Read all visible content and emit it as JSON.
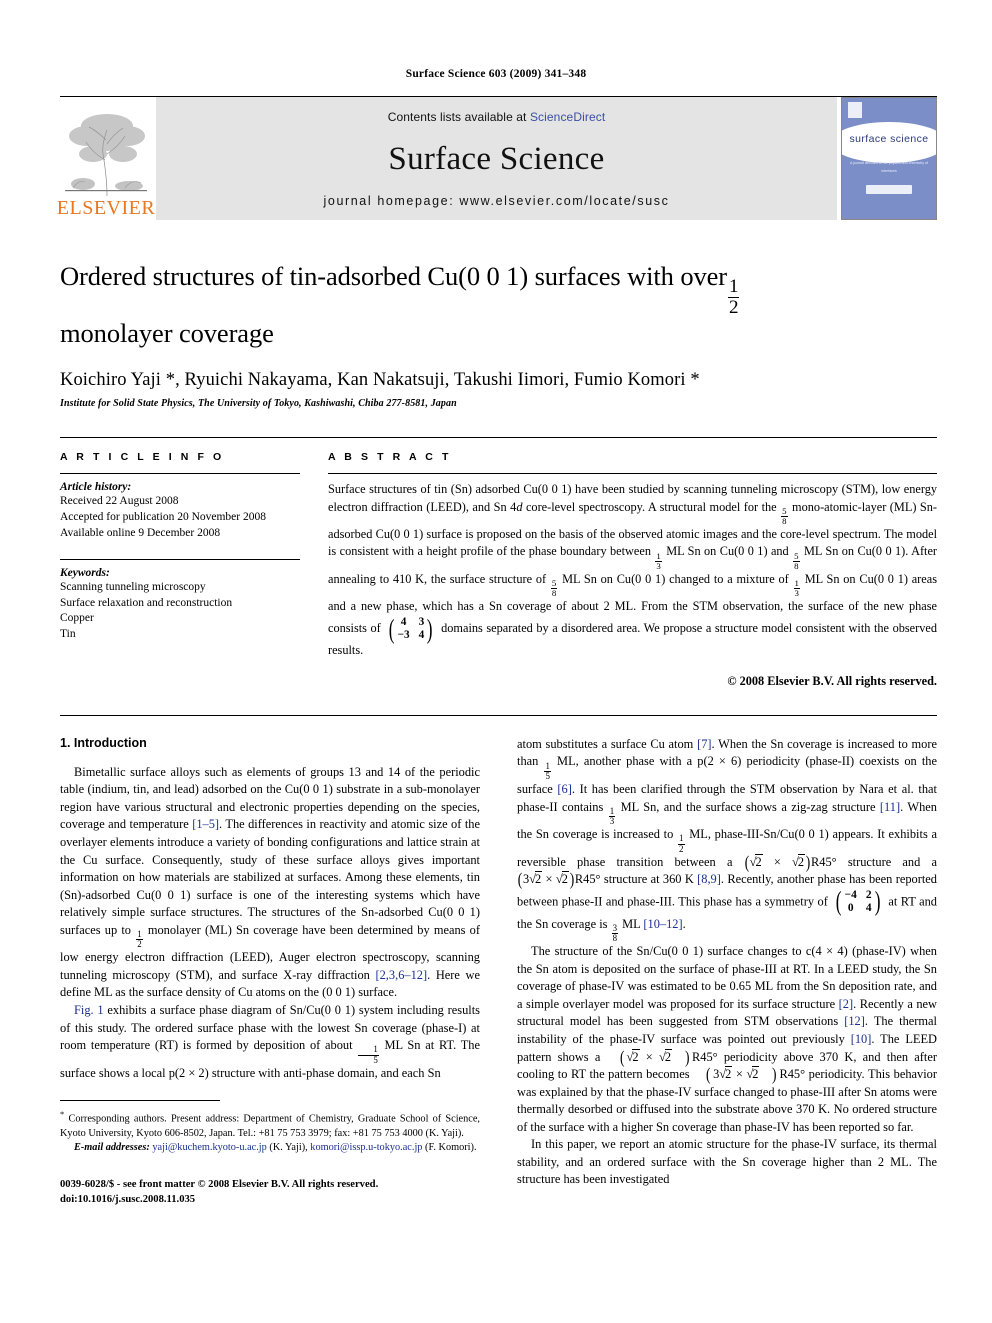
{
  "running_head": "Surface Science 603 (2009) 341–348",
  "masthead": {
    "contents_prefix": "Contents lists available at",
    "sciencedirect": "ScienceDirect",
    "journal_name": "Surface Science",
    "homepage": "journal homepage: www.elsevier.com/locate/susc",
    "elsevier_wordmark": "ELSEVIER",
    "cover_title": "surface science",
    "cover_tagline": "A journal devoted to the physics and chemistry of interfaces",
    "accent_link_color": "#3a4ea8",
    "elsevier_orange": "#E87722",
    "cover_blue": "#7b8ec8"
  },
  "article": {
    "title_line1": "Ordered structures of tin-adsorbed Cu(0 0 1) surfaces with over",
    "title_fraction": "1/2",
    "title_line2": "monolayer coverage",
    "authors": "Koichiro Yaji *, Ryuichi Nakayama, Kan Nakatsuji, Takushi Iimori, Fumio Komori *",
    "affiliation": "Institute for Solid State Physics, The University of Tokyo, Kashiwashi, Chiba 277-8581, Japan"
  },
  "article_info": {
    "heading": "A R T I C L E   I N F O",
    "history_label": "Article history:",
    "history": [
      "Received 22 August 2008",
      "Accepted for publication 20 November 2008",
      "Available online 9 December 2008"
    ],
    "keywords_label": "Keywords:",
    "keywords": [
      "Scanning tunneling microscopy",
      "Surface relaxation and reconstruction",
      "Copper",
      "Tin"
    ]
  },
  "abstract": {
    "heading": "A B S T R A C T",
    "p1_a": "Surface structures of tin (Sn) adsorbed Cu(0 0 1) have been studied by scanning tunneling microscopy (STM), low energy electron diffraction (LEED), and Sn 4",
    "p1_d": "d",
    "p1_b": " core-level spectroscopy. A structural model for the ",
    "frac_5_8": "5/8",
    "p1_c": " mono-atomic-layer (ML) Sn-adsorbed Cu(0 0 1) surface is proposed on the basis of the observed atomic images and the core-level spectrum. The model is consistent with a height profile of the phase boundary between ",
    "frac_1_3": "1/3",
    "p1_e": " ML Sn on Cu(0 0 1) and ",
    "p1_f": " ML Sn on Cu(0 0 1). After annealing to 410 K, the surface structure of ",
    "p1_g": " ML Sn on Cu(0 0 1) changed to a mixture of ",
    "p1_h": " ML Sn on Cu(0 0 1) areas and a new phase, which has a Sn coverage of about 2 ML. From the STM observation, the surface of the new phase consists of ",
    "matrix": [
      [
        "4",
        "3"
      ],
      [
        "−3",
        "4"
      ]
    ],
    "p1_i": " domains separated by a disordered area. We propose a structure model consistent with the observed results.",
    "copyright": "© 2008 Elsevier B.V. All rights reserved."
  },
  "introduction": {
    "heading": "1. Introduction",
    "left": {
      "p1_a": "Bimetallic surface alloys such as elements of groups 13 and 14 of the periodic table (indium, tin, and lead) adsorbed on the Cu(0 0 1) substrate in a sub-monolayer region have various structural and electronic properties depending on the species, coverage and temperature ",
      "ref_1_5": "[1–5]",
      "p1_b": ". The differences in reactivity and atomic size of the overlayer elements introduce a variety of bonding configurations and lattice strain at the Cu surface. Consequently, study of these surface alloys gives important information on how materials are stabilized at surfaces. Among these elements, tin (Sn)-adsorbed Cu(0 0 1) surface is one of the interesting systems which have relatively simple surface structures. The structures of the Sn-adsorbed Cu(0 0 1) surfaces up to ",
      "frac_1_2": "1/2",
      "p1_c": " monolayer (ML) Sn coverage have been determined by means of low energy electron diffraction (LEED), Auger electron spectroscopy, scanning tunneling microscopy (STM), and surface X-ray diffraction ",
      "ref_2_3_6_12": "[2,3,6–12]",
      "p1_d": ". Here we define ML as the surface density of Cu atoms on the (0 0 1) surface.",
      "p2_fig": "Fig. 1",
      "p2_a": " exhibits a surface phase diagram of Sn/Cu(0 0 1) system including results of this study. The ordered surface phase with the lowest Sn coverage (phase-I) at room temperature (RT) is formed by deposition of about ",
      "frac_1_5": "1/5",
      "p2_b": " ML Sn at RT. The surface shows a local p(2 × 2) structure with anti-phase domain, and each Sn"
    },
    "right": {
      "p1_a": "atom substitutes a surface Cu atom ",
      "ref_7": "[7]",
      "p1_b": ". When the Sn coverage is increased to more than ",
      "frac_1_5": "1/5",
      "p1_c": " ML, another phase with a p(2 × 6) periodicity (phase-II) coexists on the surface ",
      "ref_6": "[6]",
      "p1_d": ". It has been clarified through the STM observation by Nara et al. that phase-II contains ",
      "frac_1_3": "1/3",
      "p1_e": " ML Sn, and the surface shows a zig-zag structure ",
      "ref_11": "[11]",
      "p1_f": ". When the Sn coverage is increased to ",
      "frac_1_2": "1/2",
      "p1_g": " ML, phase-III-Sn/Cu(0 0 1) appears. It exhibits a reversible phase transition between a ",
      "rad_a": "(√2 × √2)R45°",
      "p1_h": " structure and a ",
      "rad_b": "(3√2 × √2)R45°",
      "p1_i": " structure at 360 K ",
      "ref_8_9": "[8,9]",
      "p1_j": ". Recently, another phase has been reported between phase-II and phase-III. This phase has a symmetry of ",
      "matrix": [
        [
          "−4",
          "2"
        ],
        [
          "0",
          "4"
        ]
      ],
      "p1_k": " at RT and the Sn coverage is ",
      "frac_3_8": "3/8",
      "p1_l": " ML ",
      "ref_10_12": "[10–12]",
      "p1_m": ".",
      "p2_a": "The structure of the Sn/Cu(0 0 1) surface changes to c(4 × 4) (phase-IV) when the Sn atom is deposited on the surface of phase-III at RT. In a LEED study, the Sn coverage of phase-IV was estimated to be 0.65 ML from the Sn deposition rate, and a simple overlayer model was proposed for its surface structure ",
      "ref_2": "[2]",
      "p2_b": ". Recently a new structural model has been suggested from STM observations ",
      "ref_12": "[12]",
      "p2_c": ". The thermal instability of the phase-IV surface was pointed out previously ",
      "ref_10": "[10]",
      "p2_d": ". The LEED pattern shows a ",
      "p2_e": " periodicity above 370 K, and then after cooling to RT the pattern becomes ",
      "p2_f": " periodicity. This behavior was explained by that the phase-IV surface changed to phase-III after Sn atoms were thermally desorbed or diffused into the substrate above 370 K. No ordered structure of the surface with a higher Sn coverage than phase-IV has been reported so far.",
      "p3": "In this paper, we report an atomic structure for the phase-IV surface, its thermal stability, and an ordered surface with the Sn coverage higher than 2 ML. The structure has been investigated"
    }
  },
  "footnotes": {
    "corresponding_marker": "*",
    "corresponding": " Corresponding authors. Present address: Department of Chemistry, Graduate School of Science, Kyoto University, Kyoto 606-8502, Japan. Tel.: +81 75 753 3979; fax: +81 75 753 4000 (K. Yaji).",
    "email_label": "E-mail addresses:",
    "email1": "yaji@kuchem.kyoto-u.ac.jp",
    "email1_who": " (K. Yaji), ",
    "email2": "komori@issp.u-tokyo.ac.jp",
    "email2_who": " (F. Komori).",
    "imprint_line1": "0039-6028/$ - see front matter © 2008 Elsevier B.V. All rights reserved.",
    "imprint_line2": "doi:10.1016/j.susc.2008.11.035"
  }
}
